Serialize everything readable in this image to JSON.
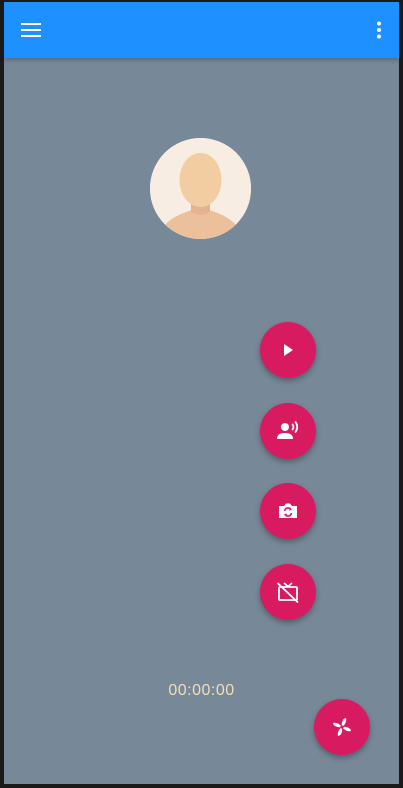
{
  "appbar": {
    "background": "#1e90ff",
    "menu_icon": "hamburger-menu-icon",
    "more_icon": "more-vert-icon"
  },
  "call": {
    "avatar_icon": "default-person-avatar",
    "timer": "00:00:00",
    "timer_color": "#f5deb3",
    "background": "#778899"
  },
  "actions": [
    {
      "name": "play",
      "icon": "play-icon"
    },
    {
      "name": "speaker",
      "icon": "record-voice-icon"
    },
    {
      "name": "switch-camera",
      "icon": "switch-camera-icon"
    },
    {
      "name": "stop-screen-share",
      "icon": "tv-off-icon"
    }
  ],
  "fab": {
    "icon": "pinwheel-icon",
    "color": "#d81b60"
  }
}
